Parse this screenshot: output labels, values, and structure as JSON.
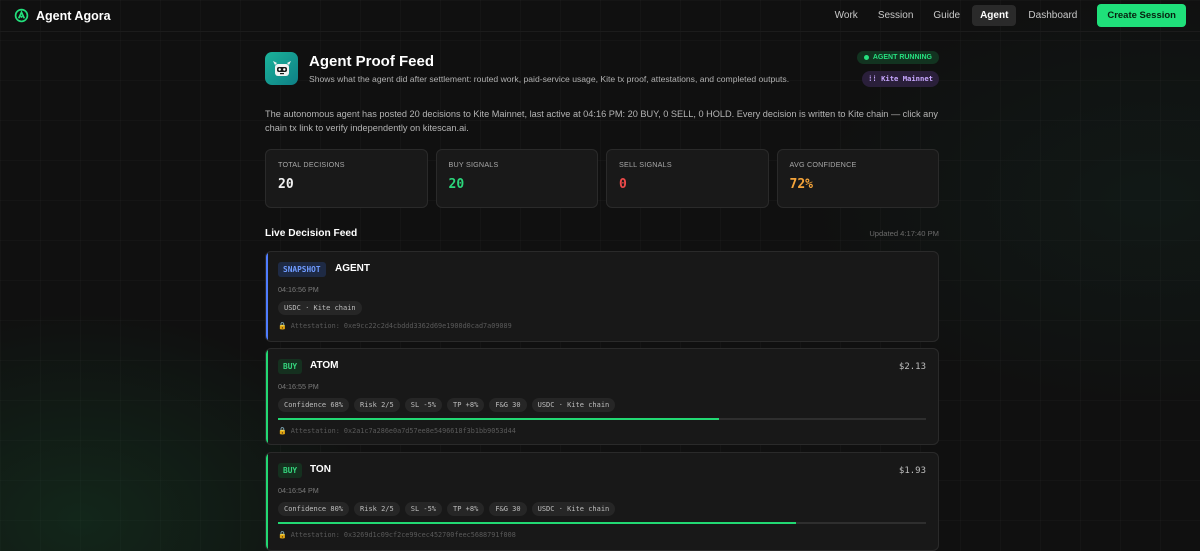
{
  "nav": {
    "brand": "Agent Agora",
    "links": [
      "Work",
      "Session",
      "Guide",
      "Agent",
      "Dashboard"
    ],
    "active": "Agent",
    "cta": "Create Session"
  },
  "header": {
    "title": "Agent Proof Feed",
    "subtitle": "Shows what the agent did after settlement: routed work, paid-service usage, Kite tx proof, attestations, and completed outputs.",
    "status_badge": "AGENT RUNNING",
    "chain_badge": "Kite Mainnet"
  },
  "summary": "The autonomous agent has posted 20 decisions to Kite Mainnet, last active at 04:16 PM: 20 BUY, 0 SELL, 0 HOLD. Every decision is written to Kite chain — click any chain tx link to verify independently on kitescan.ai.",
  "stats": [
    {
      "label": "TOTAL DECISIONS",
      "value": "20",
      "color": "#f2f2f2"
    },
    {
      "label": "BUY SIGNALS",
      "value": "20",
      "color": "#2bd67b"
    },
    {
      "label": "SELL SIGNALS",
      "value": "0",
      "color": "#ef4a4a"
    },
    {
      "label": "AVG CONFIDENCE",
      "value": "72%",
      "color": "#f5a43a"
    }
  ],
  "feed": {
    "title": "Live Decision Feed",
    "updated": "Updated 4:17:40 PM",
    "items": [
      {
        "tag": "SNAPSHOT",
        "symbol": "AGENT",
        "time": "04:16:56 PM",
        "chips": [
          "USDC · Kite chain"
        ],
        "attestation": "Attestation: 0xe9cc22c2d4cbddd3362d69e1900d0cad7a09089"
      },
      {
        "tag": "BUY",
        "symbol": "ATOM",
        "price": "$2.13",
        "time": "04:16:55 PM",
        "chips": [
          "Confidence 68%",
          "Risk 2/5",
          "SL -5%",
          "TP +8%",
          "F&G 30",
          "USDC · Kite chain"
        ],
        "confidence": 0.68,
        "attestation": "Attestation: 0x2a1c7a286e0a7d57ee8e5496618f3b1bb9053d44"
      },
      {
        "tag": "BUY",
        "symbol": "TON",
        "price": "$1.93",
        "time": "04:16:54 PM",
        "chips": [
          "Confidence 80%",
          "Risk 2/5",
          "SL -5%",
          "TP +8%",
          "F&G 30",
          "USDC · Kite chain"
        ],
        "confidence": 0.8,
        "attestation": "Attestation: 0x3269d1c09cf2ce99cec452700feec5688791f008"
      }
    ]
  }
}
